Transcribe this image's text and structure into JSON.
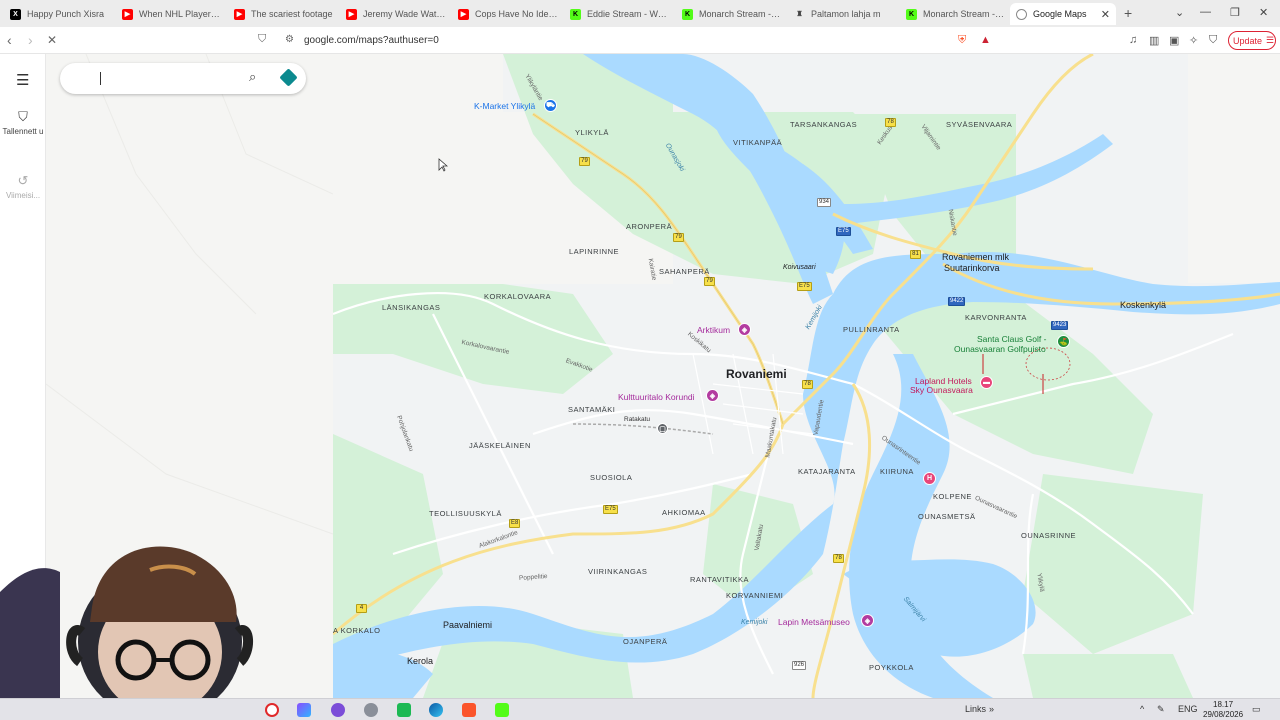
{
  "browser": {
    "tabs": [
      {
        "label": "Happy Punch Xisra",
        "icon": "x-logo-icon",
        "active": false
      },
      {
        "label": "When NHL Players We",
        "icon": "youtube-icon",
        "active": false
      },
      {
        "label": "The scariest footage",
        "icon": "youtube-icon",
        "active": false
      },
      {
        "label": "Jeremy Wade Watches",
        "icon": "youtube-icon",
        "active": false
      },
      {
        "label": "Cops Have No Idea Th",
        "icon": "youtube-icon",
        "active": false
      },
      {
        "label": "Eddie Stream - Watch",
        "icon": "kick-icon",
        "active": false
      },
      {
        "label": "Monarch Stream - Wat",
        "icon": "kick-icon",
        "active": false
      },
      {
        "label": "Paltamon lahja m",
        "icon": "group-icon",
        "active": false
      },
      {
        "label": "Monarch Stream - Wat",
        "icon": "kick-icon",
        "active": false
      },
      {
        "label": "Google Maps",
        "icon": "google-maps-icon",
        "active": true
      }
    ],
    "new_tab": "+",
    "url": "google.com/maps?authuser=0",
    "update_label": "Update"
  },
  "maps": {
    "sidebar": {
      "saved_label": "Tallennett u",
      "recent_label": "Viimeisi..."
    },
    "search": {
      "value": ""
    },
    "labels": {
      "rovaniemi": "Rovaniemi",
      "kmarket": "K-Market Ylikylä",
      "ylikyla": "YLIKYLÄ",
      "tarsankangas": "TARSANKANGAS",
      "vitikanpaa": "VITIKANPÄÄ",
      "syvasenvaara": "SYVÄSENVAARA",
      "aronpera": "ARONPERÄ",
      "lapinrinne": "LAPINRINNE",
      "sahanpera": "SAHANPERÄ",
      "koivusaari": "Koivusaari",
      "rovaniemen_mlk": "Rovaniemen mlk",
      "suutarinkorva": "Suutarinkorva",
      "lansikangas": "LÄNSIKANGAS",
      "korkalovaara": "KORKALOVAARA",
      "arktikum": "Arktikum",
      "pullinranta": "PULLINRANTA",
      "karvonranta": "KARVONRANTA",
      "koskenkyla": "Koskenkylä",
      "santa_claus_golf": "Santa Claus Golf -",
      "ounasvaaran_golfpuisto": "Ounasvaaran Golfpuisto",
      "lapland_hotels": "Lapland Hotels",
      "sky_ounasvaara": "Sky Ounasvaara",
      "korundi": "Kulttuuritalo Korundi",
      "santamaki": "SANTAMÄKI",
      "ratakatu": "Ratakatu",
      "jaaskelainen": "JÄÄSKELÄINEN",
      "katajaranta": "KATAJARANTA",
      "kiiruna": "KIIRUNA",
      "kolpene": "KOLPENE",
      "suosiola": "SUOSIOLA",
      "teollisuuskyla": "TEOLLISUUSKYLÄ",
      "ahkiomaa": "AHKIOMAA",
      "ounasmetsa": "OUNASMETSÄ",
      "ounasrinne": "OUNASRINNE",
      "viirinkangas": "VIIRINKANGAS",
      "rantavitikka": "RANTAVITIKKA",
      "korvanniemi": "KORVANNIEMI",
      "korkalo": "A KORKALO",
      "paavalniemi": "Paavalniemi",
      "metsamuseo": "Lapin Metsämuseo",
      "ojanpera": "OJANPERÄ",
      "kerola": "Kerola",
      "poykkola": "POYKKOLA",
      "kemijoki": "Kemijoki",
      "kemijoki2": "Kemijoki",
      "ounasjoki": "Ounasjoki",
      "salmijarvi": "Salmijärvi",
      "korkalovaarantie": "Korkalovaarantie",
      "koskikatu": "Koskikatu",
      "ratakatu_st": "Ratakatu",
      "evakkotie": "Evakkotie",
      "pohjolankatu": "Pohjolankatu",
      "ylikylantie": "Ylikyläntie",
      "alakorkalontie": "Alakorkalontie",
      "poppelitie": "Poppelitie",
      "ounasrinteentie": "Ounasrinteentie",
      "ounasvaarantie": "Ounasvaarantie",
      "maakuntakatu": "Maakuntakatu",
      "vapaudentie": "Vapaudentie",
      "keskustie": "Keskustie",
      "viljamintie": "Viljamintie",
      "niskantie": "Niskantie",
      "valtakatu": "Valtakatu",
      "ylikyla_st": "Ylikylä",
      "kairatie": "Kairatie"
    },
    "shields": {
      "r79a": "79",
      "r79b": "79",
      "r79c": "79",
      "r78a": "78",
      "r78b": "78",
      "r78c": "78",
      "r934": "934",
      "r81": "81",
      "e75": "E75",
      "e75b": "E75",
      "e75c": "E75",
      "e8": "E8",
      "r9422": "9422",
      "r9423": "9423",
      "r926": "926",
      "r4": "4"
    }
  },
  "taskbar": {
    "links_label": "Links",
    "language": "ENG",
    "time": "18.17",
    "date": "29/08/2026"
  },
  "colors": {
    "water": "#aadaff",
    "park": "#d4f1d8",
    "land": "#f1f3f4",
    "highway": "#f8e08e",
    "road": "#ffffff",
    "tile_blank": "#f5f5f3"
  }
}
